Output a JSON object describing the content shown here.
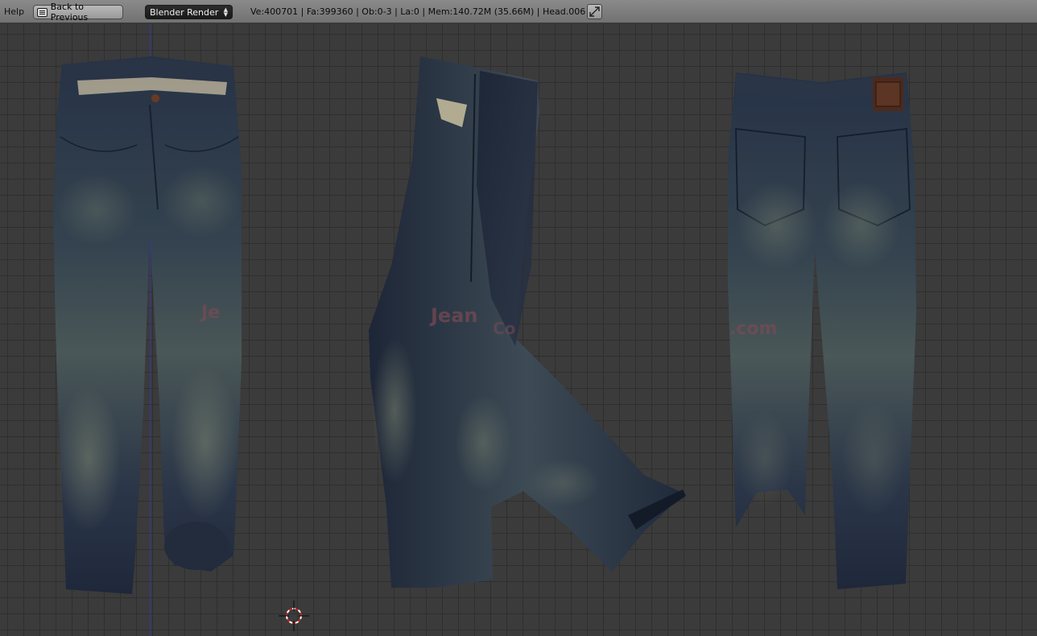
{
  "header": {
    "menu": {
      "help_label": "Help"
    },
    "back_button_label": "Back to Previous",
    "render_engine": {
      "selected": "Blender Render"
    },
    "stats": "Ve:400701 | Fa:399360 | Ob:0-3 | La:0 | Mem:140.72M (35.66M) | Head.006",
    "fullscreen_icon": "fullscreen-toggle-icon"
  },
  "viewport": {
    "objects": [
      {
        "name": "jeans-front-view",
        "icon": "mesh"
      },
      {
        "name": "jeans-side-view",
        "icon": "mesh"
      },
      {
        "name": "jeans-back-view",
        "icon": "mesh"
      }
    ],
    "cursor_icon": "3d-cursor-icon",
    "colors": {
      "background": "#393939",
      "grid": "#2f2f2f",
      "z_axis": "#2f38a8",
      "denim_dark": "#1f2a3c",
      "denim_light": "#5b6a6a",
      "watermark": "#7a4a55"
    }
  }
}
